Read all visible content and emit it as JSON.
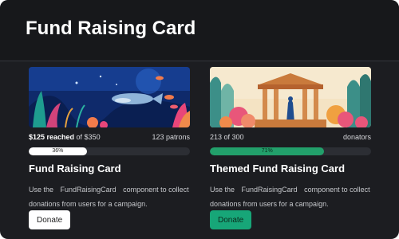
{
  "page": {
    "title": "Fund Raising Card"
  },
  "cards": [
    {
      "stats_left_amount": "$125 reached",
      "stats_left_rest": " of $350",
      "stats_right": "123 patrons",
      "progress_label": "36%",
      "progress_value": 0.36,
      "title": "Fund Raising Card",
      "desc_pre": "Use the",
      "desc_code": "FundRaisingCard",
      "desc_post": "component to collect donations from users for a campaign.",
      "button": "Donate"
    },
    {
      "stats_left_amount": "",
      "stats_left_rest": "213 of 300",
      "stats_right": "donators",
      "progress_label": "71%",
      "progress_value": 0.71,
      "title": "Themed Fund Raising Card",
      "desc_pre": "Use the",
      "desc_code": "FundRaisingCard",
      "desc_post": "component to collect donations from users for a campaign.",
      "button": "Donate"
    }
  ],
  "colors": {
    "background": "#1c1d21",
    "accent_green": "#17a678",
    "button_light": "#ffffff"
  }
}
